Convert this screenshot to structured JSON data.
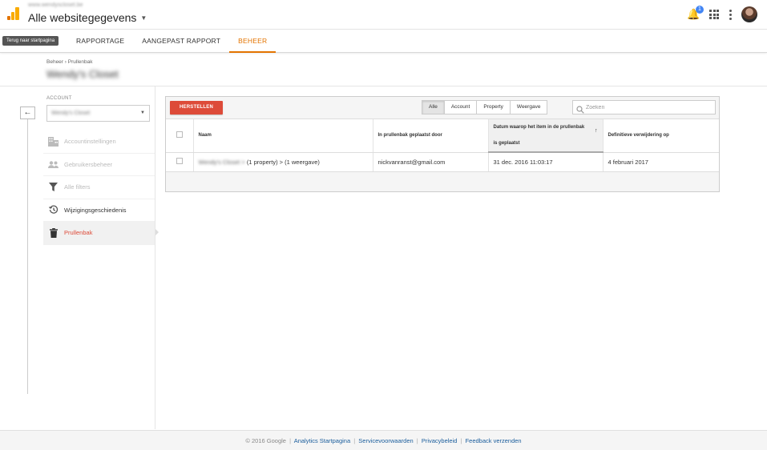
{
  "header": {
    "subtitle": "www.wendyscloset.be",
    "title": "Alle websitegegevens",
    "notification_count": "1"
  },
  "nav": {
    "back_label": "Terug naar startpagina",
    "tabs": [
      {
        "label": "RAPPORTAGE"
      },
      {
        "label": "AANGEPAST RAPPORT"
      },
      {
        "label": "BEHEER"
      }
    ]
  },
  "breadcrumb": {
    "root": "Beheer",
    "separator": "›",
    "current": "Prullenbak"
  },
  "page_title": "Wendy's Closet",
  "account": {
    "label": "ACCOUNT",
    "selected": "Wendy's Closet"
  },
  "sidebar": {
    "items": [
      {
        "label": "Accountinstellingen",
        "icon": "building-icon"
      },
      {
        "label": "Gebruikersbeheer",
        "icon": "people-icon"
      },
      {
        "label": "Alle filters",
        "icon": "filter-icon"
      },
      {
        "label": "Wijzigingsgeschiedenis",
        "icon": "history-icon"
      },
      {
        "label": "Prullenbak",
        "icon": "trash-icon"
      }
    ]
  },
  "toolbar": {
    "restore_label": "HERSTELLEN",
    "filters": [
      "Alle",
      "Account",
      "Property",
      "Weergave"
    ],
    "search_placeholder": "Zoeken"
  },
  "table": {
    "columns": {
      "name": "Naam",
      "trashed_by": "In prullenbak geplaatst door",
      "trashed_on_line1": "Datum waarop het item in de prullenbak",
      "trashed_on_line2": "is geplaatst",
      "deletion": "Definitieve verwijdering op"
    },
    "rows": [
      {
        "name_account": "Wendy's Closet",
        "name_arrow": ">",
        "name_rest": "(1 property) > (1 weergave)",
        "trashed_by": "nickvanranst@gmail.com",
        "trashed_on": "31 dec. 2016 11:03:17",
        "deletion": "4 februari 2017"
      }
    ]
  },
  "footer": {
    "copyright": "© 2016 Google",
    "links": [
      "Analytics Startpagina",
      "Servicevoorwaarden",
      "Privacybeleid",
      "Feedback verzenden"
    ]
  },
  "colors": {
    "accent": "#e37400",
    "danger": "#dd4b39",
    "link": "#1a5d9c"
  }
}
